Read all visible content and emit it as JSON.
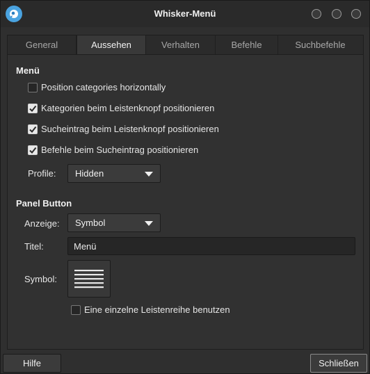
{
  "window": {
    "title": "Whisker-Menü"
  },
  "tabs": [
    {
      "label": "General"
    },
    {
      "label": "Aussehen"
    },
    {
      "label": "Verhalten"
    },
    {
      "label": "Befehle"
    },
    {
      "label": "Suchbefehle"
    }
  ],
  "active_tab": "Aussehen",
  "menu_section": {
    "title": "Menü",
    "options": [
      {
        "label": "Position categories horizontally",
        "checked": false
      },
      {
        "label": "Kategorien beim Leistenknopf positionieren",
        "checked": true
      },
      {
        "label": "Sucheintrag beim Leistenknopf positionieren",
        "checked": true
      },
      {
        "label": "Befehle beim Sucheintrag positionieren",
        "checked": true
      }
    ],
    "profile_label": "Profile:",
    "profile_value": "Hidden"
  },
  "panel_section": {
    "title": "Panel Button",
    "display_label": "Anzeige:",
    "display_value": "Symbol",
    "title_label": "Titel:",
    "title_value": "Menü",
    "symbol_label": "Symbol:",
    "symbol_icon": "menu-lines-icon",
    "single_row_label": "Eine einzelne Leistenreihe benutzen",
    "single_row_checked": false
  },
  "footer": {
    "help_label": "Hilfe",
    "close_label": "Schließen"
  }
}
